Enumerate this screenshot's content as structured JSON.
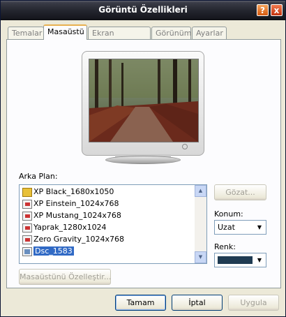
{
  "window": {
    "title": "Görüntü Özellikleri",
    "help_label": "?",
    "close_label": "x"
  },
  "tabs": [
    {
      "label": "Temalar",
      "active": false
    },
    {
      "label": "Masaüstü",
      "active": true
    },
    {
      "label": "Ekran Koruyucu",
      "active": false
    },
    {
      "label": "Görünüm",
      "active": false
    },
    {
      "label": "Ayarlar",
      "active": false
    }
  ],
  "background_label": "Arka Plan:",
  "background_list": [
    {
      "label": "XP Black_1680x1050",
      "icon": "html-file-icon"
    },
    {
      "label": "XP Einstein_1024x768",
      "icon": "image-file-icon"
    },
    {
      "label": "XP Mustang_1024x768",
      "icon": "image-file-icon"
    },
    {
      "label": "Yaprak_1280x1024",
      "icon": "image-file-icon"
    },
    {
      "label": "Zero Gravity_1024x768",
      "icon": "image-file-icon"
    },
    {
      "label": "Dsc_1583",
      "icon": "image-file-icon",
      "selected": true
    }
  ],
  "browse_button": "Gözat...",
  "position_label": "Konum:",
  "position_value": "Uzat",
  "color_label": "Renk:",
  "color_value": "#1f3b52",
  "customize_button": "Masaüstünü Özelleştir...",
  "buttons": {
    "ok": "Tamam",
    "cancel": "İptal",
    "apply": "Uygula"
  }
}
